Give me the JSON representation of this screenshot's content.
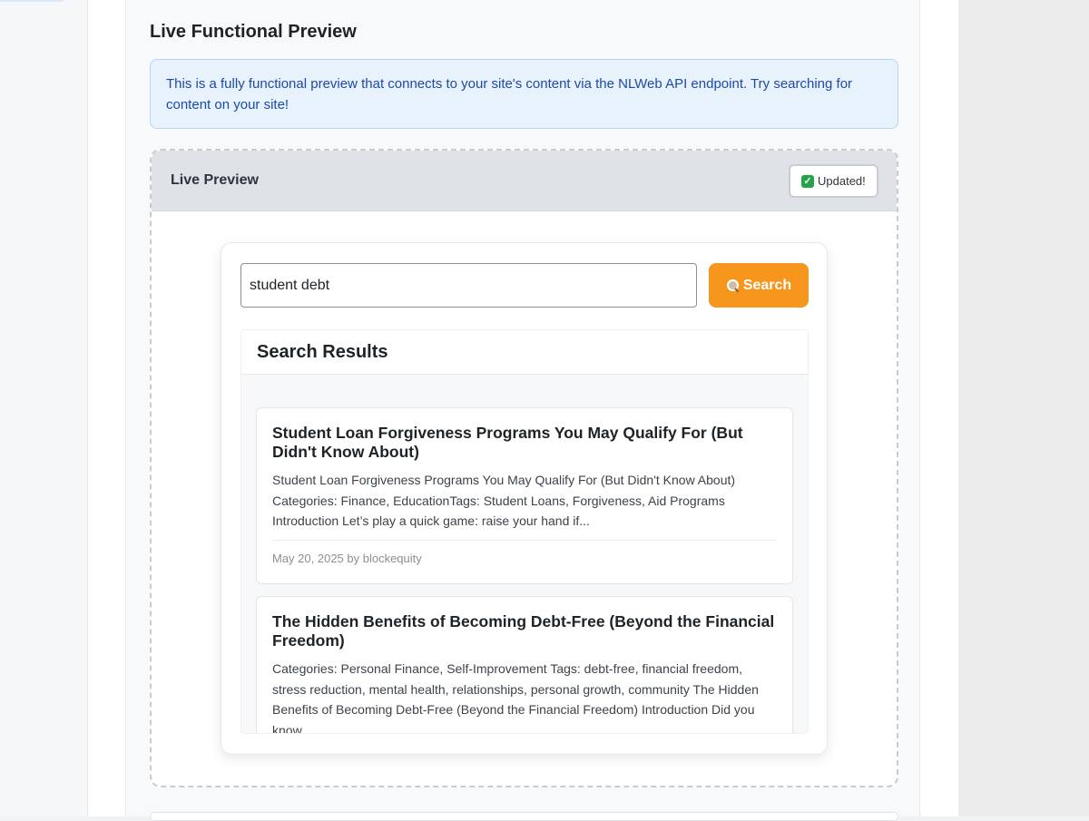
{
  "section": {
    "title": "Live Functional Preview",
    "info_text": "This is a fully functional preview that connects to your site's content via the NLWeb API endpoint. Try searching for content on your site!"
  },
  "preview": {
    "title": "Live Preview",
    "badge_label": "Updated!",
    "badge_icon": "check-mark-icon"
  },
  "search": {
    "value": "student debt",
    "button_label": "Search",
    "button_icon": "magnifier-icon",
    "button_color": "#f7961c"
  },
  "results": {
    "title": "Search Results",
    "items": [
      {
        "title": "Student Loan Forgiveness Programs You May Qualify For (But Didn't Know About)",
        "snippet": "Student Loan Forgiveness Programs You May Qualify For (But Didn't Know About) Categories: Finance, EducationTags: Student Loans, Forgiveness, Aid Programs Introduction Let’s play a quick game: raise your hand if...",
        "meta": "May 20, 2025 by blockequity"
      },
      {
        "title": "The Hidden Benefits of Becoming Debt-Free (Beyond the Financial Freedom)",
        "snippet": "Categories: Personal Finance, Self-Improvement Tags: debt-free, financial freedom, stress reduction, mental health, relationships, personal growth, community The Hidden Benefits of Becoming Debt-Free (Beyond the Financial Freedom) Introduction Did you know..."
      }
    ]
  },
  "colors": {
    "info_background": "#e8f2fd",
    "info_text": "#1b4aa8",
    "badge_check": "#22a447"
  }
}
